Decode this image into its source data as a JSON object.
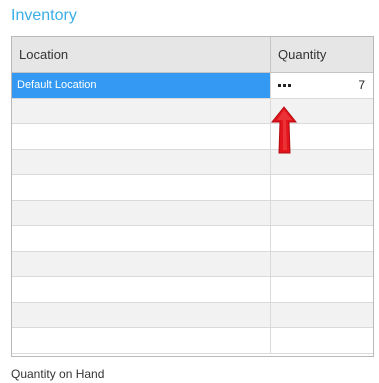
{
  "panel": {
    "title": "Inventory"
  },
  "table": {
    "columns": [
      "Location",
      "Quantity"
    ],
    "rows": [
      {
        "location": "Default Location",
        "quantity": "7",
        "selected": true
      }
    ],
    "empty_rows": 10
  },
  "footer": {
    "label": "Quantity on Hand"
  },
  "colors": {
    "title": "#3aaee6",
    "selection": "#3399f3",
    "annotation_arrow": "#e3141b"
  },
  "icons": {
    "ellipsis": "more-options-icon",
    "annotation": "red-arrow-up-icon"
  }
}
